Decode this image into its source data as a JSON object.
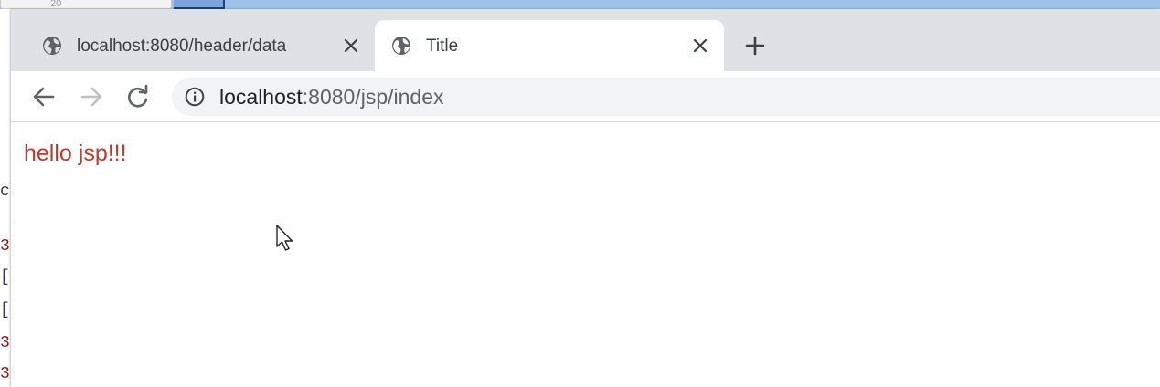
{
  "background": {
    "field_value": "20",
    "left_letters": [
      "ca",
      "3",
      "[",
      "[",
      "3",
      "3"
    ],
    "colors": {
      "title_bar": "#9ec1e8",
      "code_red": "#8b1a1a",
      "code_purple": "#3b2e7a"
    }
  },
  "browser": {
    "tabs": [
      {
        "label": "localhost:8080/header/data",
        "icon": "globe-icon",
        "active": false
      },
      {
        "label": "Title",
        "icon": "globe-icon",
        "active": true
      }
    ],
    "new_tab_icon": "plus-icon",
    "nav": {
      "back_icon": "arrow-left-icon",
      "forward_icon": "arrow-right-icon",
      "reload_icon": "reload-icon"
    },
    "address": {
      "icon": "info-icon",
      "host": "localhost",
      "rest": ":8080/jsp/index"
    }
  },
  "page": {
    "text": "hello jsp!!!",
    "text_color": "#c0392b"
  }
}
